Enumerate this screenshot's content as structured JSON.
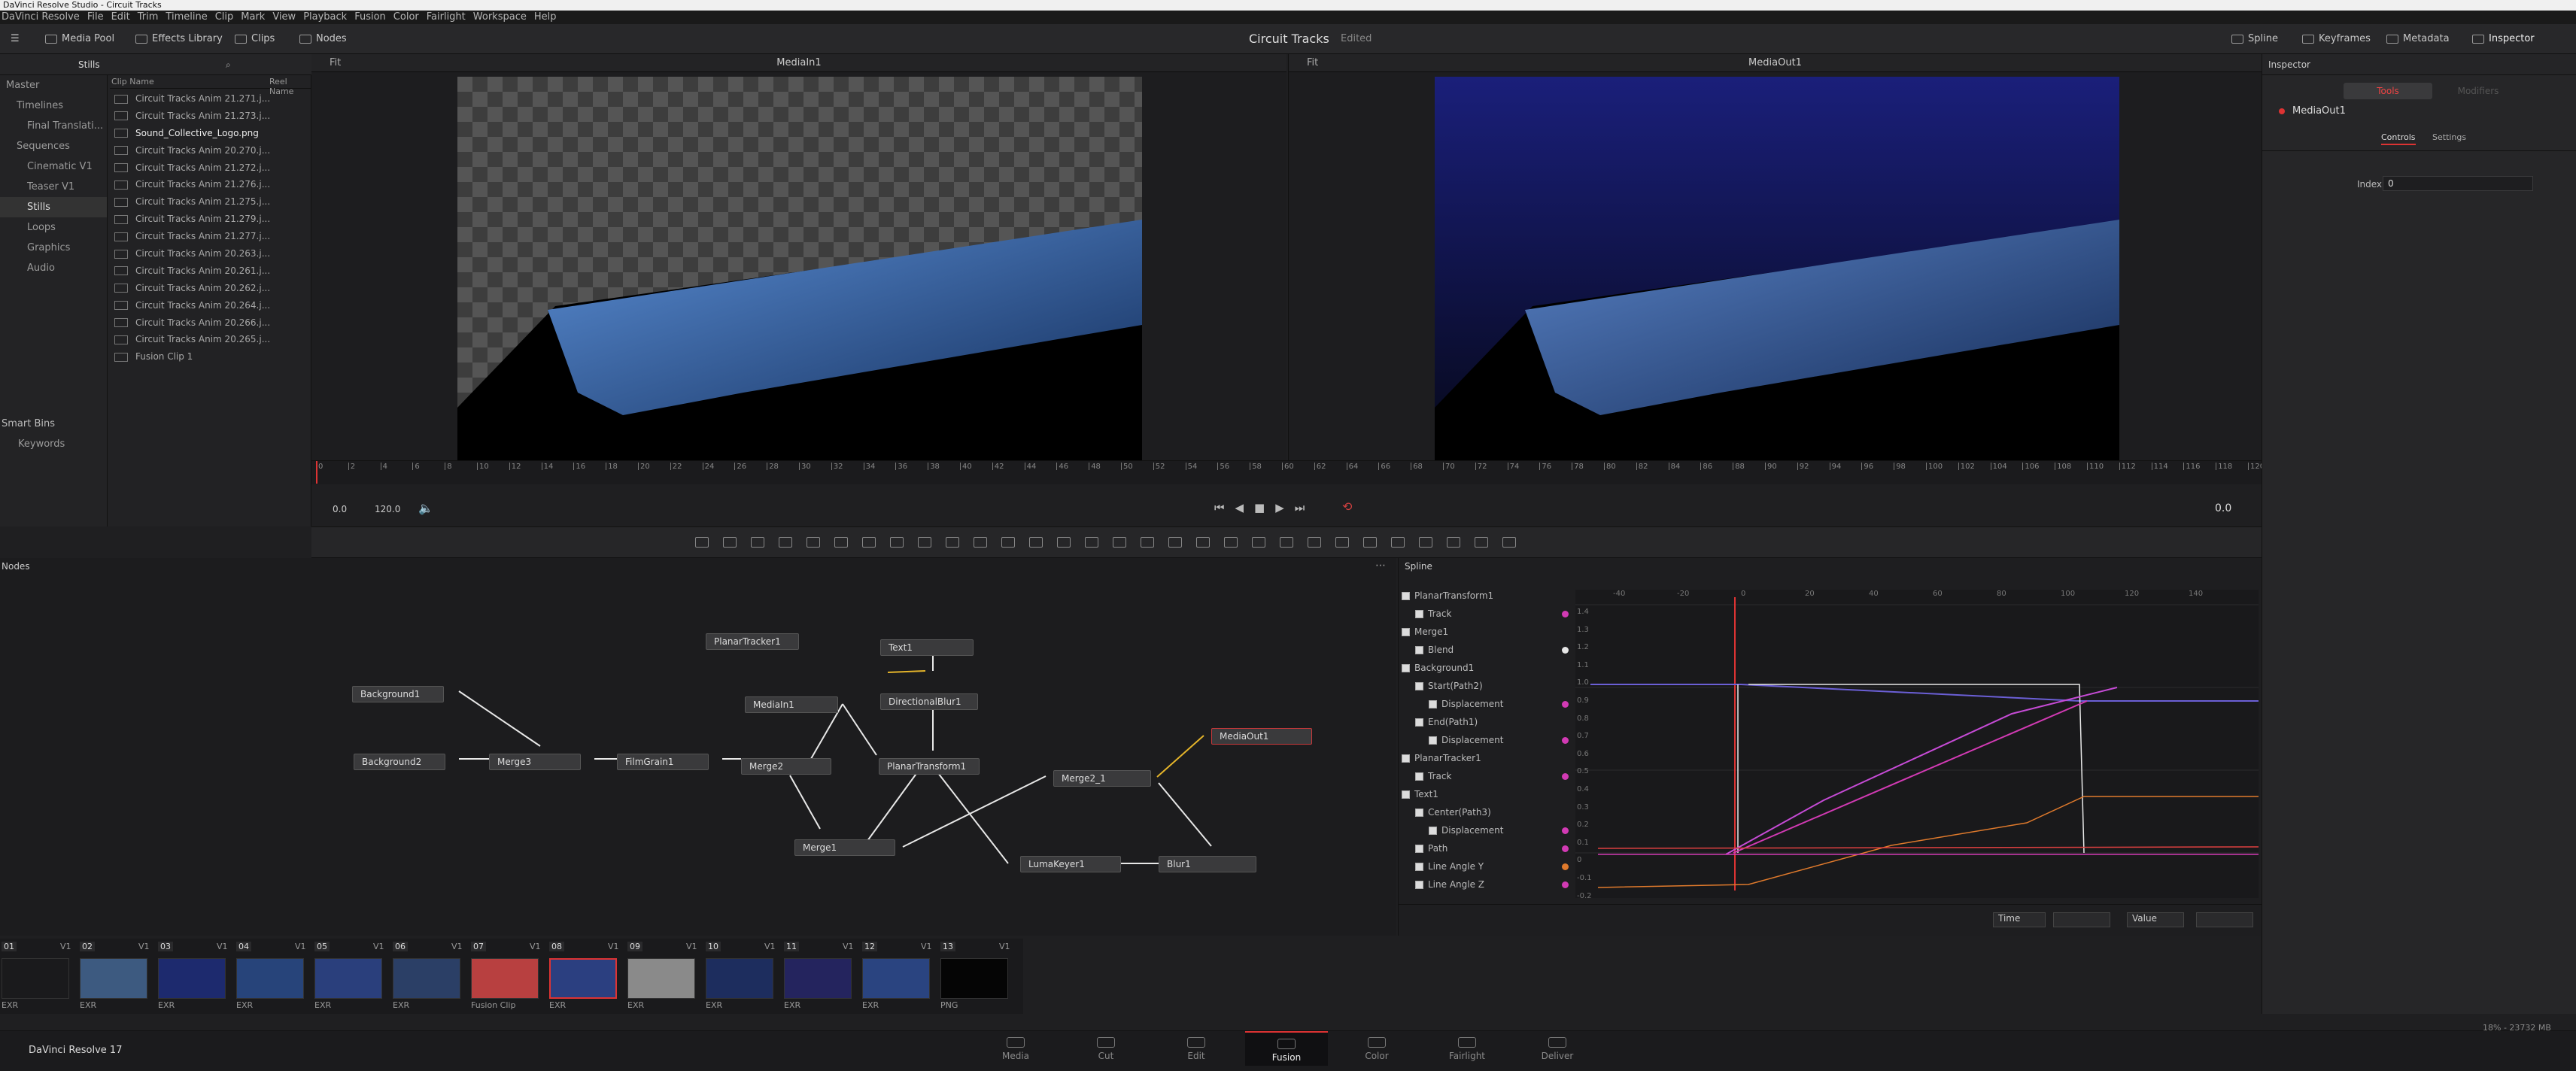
{
  "window_title": "DaVinci Resolve Studio - Circuit Tracks",
  "menu": [
    "DaVinci Resolve",
    "File",
    "Edit",
    "Trim",
    "Timeline",
    "Clip",
    "Mark",
    "View",
    "Playback",
    "Fusion",
    "Color",
    "Fairlight",
    "Workspace",
    "Help"
  ],
  "toolbar": {
    "media_pool": "Media Pool",
    "effects_library": "Effects Library",
    "clips": "Clips",
    "nodes": "Nodes",
    "project": "Circuit Tracks",
    "status": "Edited",
    "spline": "Spline",
    "keyframes": "Keyframes",
    "metadata": "Metadata",
    "inspector": "Inspector"
  },
  "mediapool": {
    "current_bin": "Stills",
    "col_clip": "Clip Name",
    "col_reel": "Reel Name",
    "bins": [
      "Master",
      "Timelines",
      "Final Translati...",
      "Sequences",
      "Cinematic V1",
      "Teaser V1",
      "Stills",
      "Loops",
      "Graphics",
      "Audio"
    ],
    "smart_bins": "Smart Bins",
    "keywords": "Keywords",
    "clips": [
      "Circuit Tracks Anim 21.271.j...",
      "Circuit Tracks Anim 21.273.j...",
      "Sound_Collective_Logo.png",
      "Circuit Tracks Anim 20.270.j...",
      "Circuit Tracks Anim 21.272.j...",
      "Circuit Tracks Anim 21.276.j...",
      "Circuit Tracks Anim 21.275.j...",
      "Circuit Tracks Anim 21.279.j...",
      "Circuit Tracks Anim 21.277.j...",
      "Circuit Tracks Anim 20.263.j...",
      "Circuit Tracks Anim 20.261.j...",
      "Circuit Tracks Anim 20.262.j...",
      "Circuit Tracks Anim 20.264.j...",
      "Circuit Tracks Anim 20.266.j...",
      "Circuit Tracks Anim 20.265.j...",
      "Fusion Clip 1"
    ]
  },
  "viewers": {
    "left_title": "MediaIn1",
    "right_title": "MediaOut1",
    "fit": "Fit"
  },
  "ruler_ticks": [
    "0",
    "2",
    "4",
    "6",
    "8",
    "10",
    "12",
    "14",
    "16",
    "18",
    "20",
    "22",
    "24",
    "26",
    "28",
    "30",
    "32",
    "34",
    "36",
    "38",
    "40",
    "42",
    "44",
    "46",
    "48",
    "50",
    "52",
    "54",
    "56",
    "58",
    "60",
    "62",
    "64",
    "66",
    "68",
    "70",
    "72",
    "74",
    "76",
    "78",
    "80",
    "82",
    "84",
    "86",
    "88",
    "90",
    "92",
    "94",
    "96",
    "98",
    "100",
    "102",
    "104",
    "106",
    "108",
    "110",
    "112",
    "114",
    "116",
    "118",
    "120"
  ],
  "transport": {
    "start": "0.0",
    "end": "120.0",
    "current": "0.0"
  },
  "nodes_panel": {
    "title": "Nodes",
    "nodes": [
      "Background1",
      "Background2",
      "Merge3",
      "FilmGrain1",
      "Merge2",
      "PlanarTracker1",
      "MediaIn1",
      "Text1",
      "DirectionalBlur1",
      "PlanarTransform1",
      "Merge2_1",
      "MediaOut1",
      "Merge1",
      "LumaKeyer1",
      "Blur1"
    ]
  },
  "spline_panel": {
    "title": "Spline",
    "rows": [
      {
        "label": "PlanarTransform1",
        "indent": 0,
        "color": ""
      },
      {
        "label": "Track",
        "indent": 1,
        "color": "#d23ab4"
      },
      {
        "label": "Merge1",
        "indent": 0,
        "color": ""
      },
      {
        "label": "Blend",
        "indent": 1,
        "color": "#e6e6e6"
      },
      {
        "label": "Background1",
        "indent": 0,
        "color": ""
      },
      {
        "label": "Start(Path2)",
        "indent": 1,
        "color": ""
      },
      {
        "label": "Displacement",
        "indent": 2,
        "color": "#d23ab4"
      },
      {
        "label": "End(Path1)",
        "indent": 1,
        "color": ""
      },
      {
        "label": "Displacement",
        "indent": 2,
        "color": "#d23ab4"
      },
      {
        "label": "PlanarTracker1",
        "indent": 0,
        "color": ""
      },
      {
        "label": "Track",
        "indent": 1,
        "color": "#d23ab4"
      },
      {
        "label": "Text1",
        "indent": 0,
        "color": ""
      },
      {
        "label": "Center(Path3)",
        "indent": 1,
        "color": ""
      },
      {
        "label": "Displacement",
        "indent": 2,
        "color": "#d23ab4"
      },
      {
        "label": "Path",
        "indent": 1,
        "color": "#d23ab4"
      },
      {
        "label": "Line Angle Y",
        "indent": 1,
        "color": "#e07a2c"
      },
      {
        "label": "Line Angle Z",
        "indent": 1,
        "color": "#d23ab4"
      }
    ],
    "x_ticks": [
      "-40",
      "-20",
      "0",
      "20",
      "40",
      "60",
      "80",
      "100",
      "120",
      "140"
    ],
    "y_ticks": [
      "1.4",
      "1.3",
      "1.2",
      "1.1",
      "1.0",
      "0.9",
      "0.8",
      "0.7",
      "0.6",
      "0.5",
      "0.4",
      "0.3",
      "0.2",
      "0.1",
      "0",
      "-0.1",
      "-0.2"
    ],
    "time_label": "Time",
    "value_label": "Value"
  },
  "inspector": {
    "title": "Inspector",
    "tab_tools": "Tools",
    "tab_modifiers": "Modifiers",
    "node": "MediaOut1",
    "controls": "Controls",
    "settings": "Settings",
    "index_label": "Index",
    "index_value": "0"
  },
  "thumbnails": [
    {
      "num": "01",
      "track": "V1",
      "fmt": "EXR"
    },
    {
      "num": "02",
      "track": "V1",
      "fmt": "EXR"
    },
    {
      "num": "03",
      "track": "V1",
      "fmt": "EXR"
    },
    {
      "num": "04",
      "track": "V1",
      "fmt": "EXR"
    },
    {
      "num": "05",
      "track": "V1",
      "fmt": "EXR"
    },
    {
      "num": "06",
      "track": "V1",
      "fmt": "EXR"
    },
    {
      "num": "07",
      "track": "V1",
      "fmt": "Fusion Clip"
    },
    {
      "num": "08",
      "track": "V1",
      "fmt": "EXR"
    },
    {
      "num": "09",
      "track": "V1",
      "fmt": "EXR"
    },
    {
      "num": "10",
      "track": "V1",
      "fmt": "EXR"
    },
    {
      "num": "11",
      "track": "V1",
      "fmt": "EXR"
    },
    {
      "num": "12",
      "track": "V1",
      "fmt": "EXR"
    },
    {
      "num": "13",
      "track": "V1",
      "fmt": "PNG"
    }
  ],
  "memory": "18% - 23732 MB",
  "app_name": "DaVinci Resolve 17",
  "pages": [
    "Media",
    "Cut",
    "Edit",
    "Fusion",
    "Color",
    "Fairlight",
    "Deliver"
  ]
}
